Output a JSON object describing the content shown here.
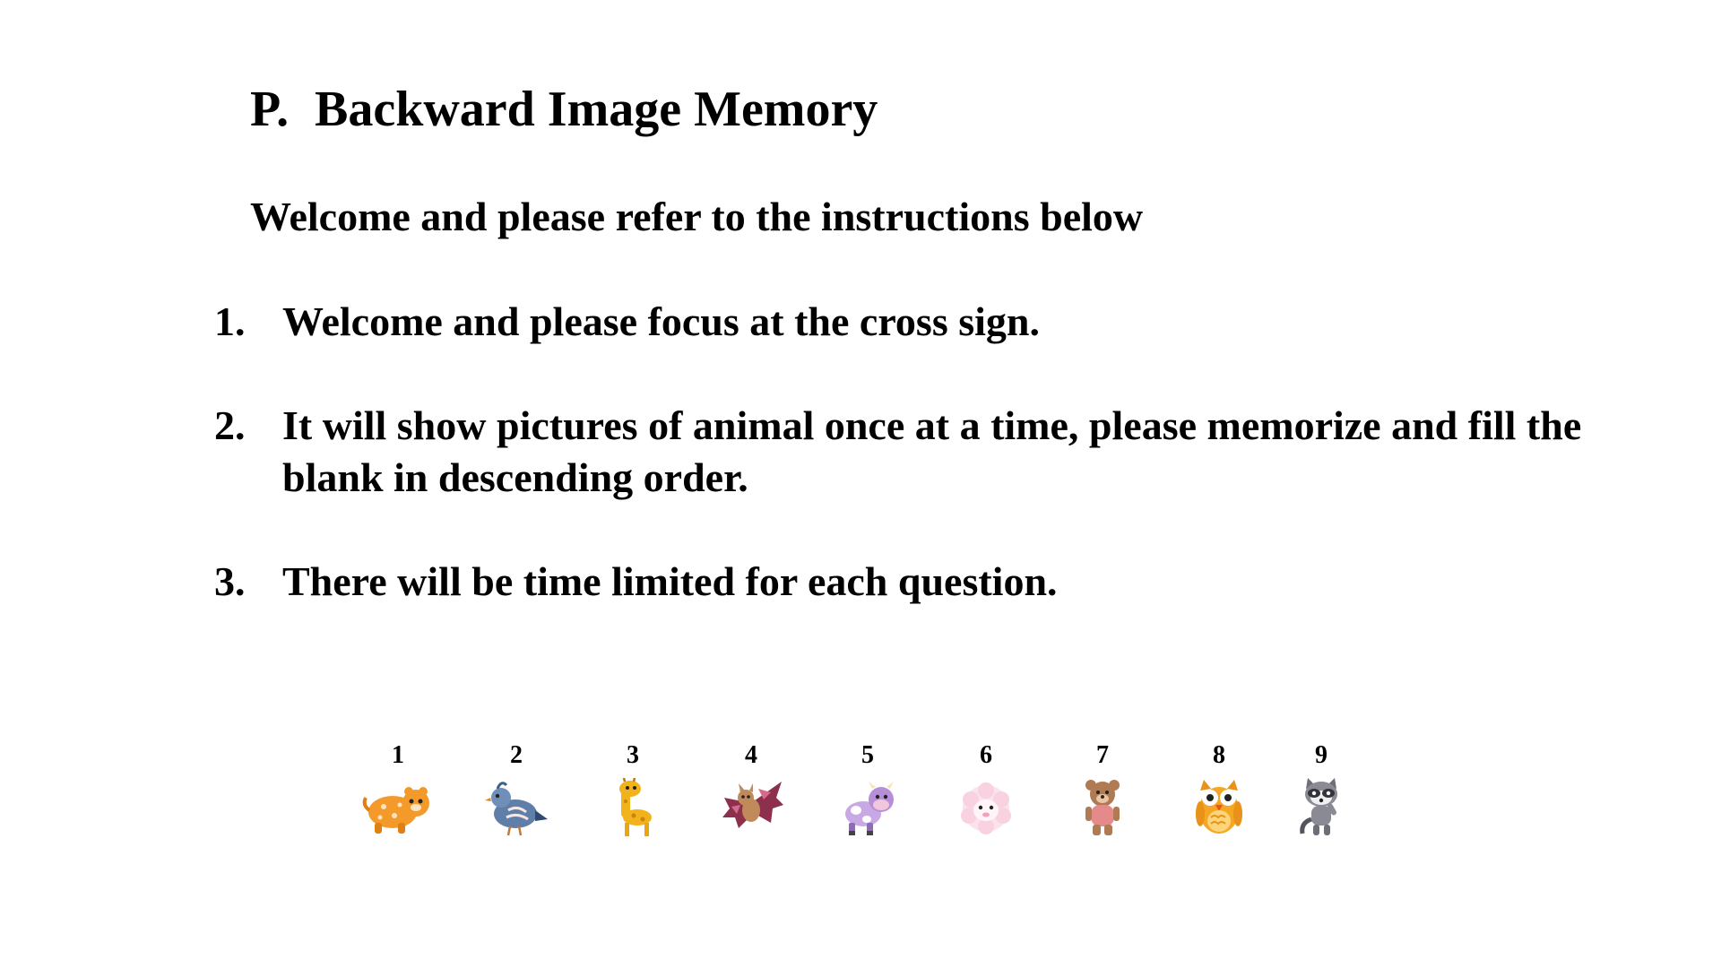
{
  "title": {
    "prefix": "P.",
    "text": "Backward Image Memory"
  },
  "subtitle": "Welcome and please refer to the instructions below",
  "instructions": [
    {
      "number": "1.",
      "text": "Welcome and please focus at the cross sign."
    },
    {
      "number": "2.",
      "text": "It will show pictures of animal once at a time, please memorize and fill the blank in descending order."
    },
    {
      "number": "3.",
      "text": "There will be time limited for each question."
    }
  ],
  "animals": [
    {
      "label": "1",
      "icon": "tiger-icon",
      "color": "#F39A2B"
    },
    {
      "label": "2",
      "icon": "quail-icon",
      "color": "#3E5E8C"
    },
    {
      "label": "3",
      "icon": "giraffe-icon",
      "color": "#F2B21C"
    },
    {
      "label": "4",
      "icon": "bat-icon",
      "color": "#8E2F4E"
    },
    {
      "label": "5",
      "icon": "cow-icon",
      "color": "#B78FD8"
    },
    {
      "label": "6",
      "icon": "sheep-icon",
      "color": "#F4C8D6"
    },
    {
      "label": "7",
      "icon": "bear-icon",
      "color": "#B07A52"
    },
    {
      "label": "8",
      "icon": "owl-icon",
      "color": "#F5A623"
    },
    {
      "label": "9",
      "icon": "raccoon-icon",
      "color": "#6E6E78"
    }
  ]
}
